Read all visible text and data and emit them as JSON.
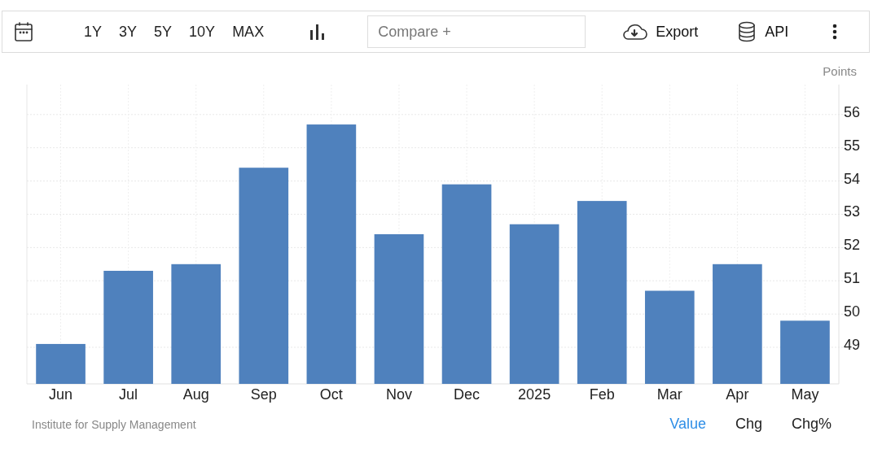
{
  "toolbar": {
    "ranges": [
      "1Y",
      "3Y",
      "5Y",
      "10Y",
      "MAX"
    ],
    "compare": {
      "placeholder": "Compare +"
    },
    "actions": [
      {
        "kind": "export",
        "label": "Export"
      },
      {
        "kind": "api",
        "label": "API"
      }
    ]
  },
  "chart": {
    "unit": "Points",
    "chart_data": {
      "type": "bar",
      "categories": [
        "Jun",
        "Jul",
        "Aug",
        "Sep",
        "Oct",
        "Nov",
        "Dec",
        "2025",
        "Feb",
        "Mar",
        "Apr",
        "May"
      ],
      "values": [
        49.1,
        51.3,
        51.5,
        54.4,
        55.7,
        52.4,
        53.9,
        52.7,
        53.4,
        50.7,
        51.5,
        49.8
      ],
      "ylim": [
        47.9,
        56.9
      ],
      "grid": true,
      "yticks": [
        49,
        50,
        51,
        52,
        53,
        54,
        55,
        56
      ]
    }
  },
  "footer": {
    "source": "Institute for Supply Management",
    "tabs": [
      {
        "label": "Value",
        "selected": true
      },
      {
        "label": "Chg",
        "selected": false
      },
      {
        "label": "Chg%",
        "selected": false
      }
    ]
  }
}
